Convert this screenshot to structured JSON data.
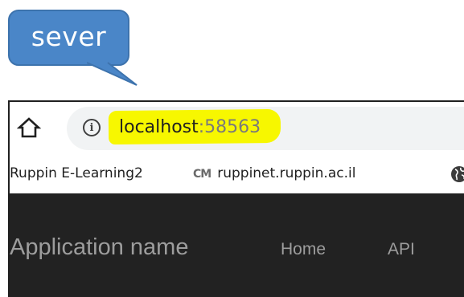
{
  "callout": {
    "text": "sever",
    "fill": "#4a86c8"
  },
  "toolbar": {
    "home_icon": "home-icon",
    "info_icon": "info-icon",
    "url_host": "localhost",
    "url_port": ":58563",
    "highlight_color": "#f7f700"
  },
  "bookmarks": {
    "items": [
      {
        "label": "Ruppin E-Learning2"
      },
      {
        "logo": "CM",
        "label": "ruppinet.ruppin.ac.il"
      }
    ],
    "overflow_icon": "globe-icon"
  },
  "navbar": {
    "brand": "Application name",
    "links": [
      {
        "label": "Home"
      },
      {
        "label": "API"
      }
    ],
    "background": "#222222"
  }
}
